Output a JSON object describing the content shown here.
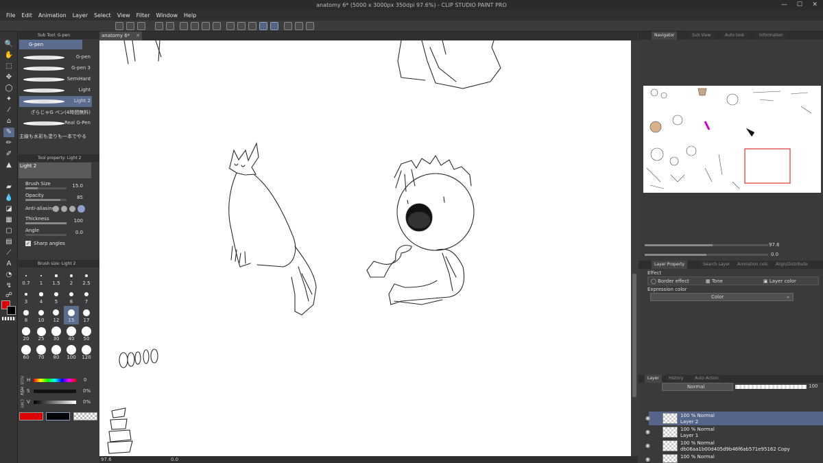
{
  "window": {
    "title": "anatomy 6* (5000 x 3000px 350dpi 97.6%) - CLIP STUDIO PAINT PRO",
    "controls": [
      "—",
      "☐",
      "✕"
    ]
  },
  "menu": [
    "File",
    "Edit",
    "Animation",
    "Layer",
    "Select",
    "View",
    "Filter",
    "Window",
    "Help"
  ],
  "subtool": {
    "panel_title": "Sub Tool: G-pen",
    "group": "G-pen",
    "brushes": [
      "G-pen",
      "G-pen 3",
      "SemiHard",
      "Light",
      "Light 2",
      "ざらじゃG ペン(4時間無料)",
      "Real G-Pen",
      "主線も水彩も塗りも一本でやる"
    ],
    "selected_index": 4
  },
  "tool_property": {
    "panel_title": "Tool property: Light 2",
    "preset": "Light 2",
    "props": [
      {
        "label": "Brush Size",
        "value": "15.0",
        "fill": 0.3
      },
      {
        "label": "Opacity",
        "value": "85",
        "fill": 0.85
      },
      {
        "label": "Anti-aliasing",
        "value": "",
        "fill": 0
      },
      {
        "label": "Thickness",
        "value": "100",
        "fill": 1.0
      },
      {
        "label": "Angle",
        "value": "0.0",
        "fill": 0
      }
    ],
    "sharp_angles": "Sharp angles"
  },
  "brush_size": {
    "panel_title": "Brush size: Light 2",
    "sizes": [
      "0.7",
      "1",
      "1.5",
      "2",
      "2.5",
      "3",
      "4",
      "5",
      "6",
      "7",
      "8",
      "10",
      "12",
      "15",
      "17",
      "20",
      "25",
      "30",
      "40",
      "50",
      "60",
      "70",
      "80",
      "100",
      "120"
    ],
    "selected": "15"
  },
  "color": {
    "mode_tabs": [
      "HSV",
      "RGB",
      "CMY"
    ],
    "sliders": [
      {
        "label": "H",
        "value": "0"
      },
      {
        "label": "S",
        "value": "0%"
      },
      {
        "label": "V",
        "value": "0%"
      }
    ],
    "main_color": "#dd0000",
    "sub_color": "#000000"
  },
  "canvas": {
    "tab_label": "anatomy 6*"
  },
  "status": {
    "zoom": "97.6",
    "angle": "0.0"
  },
  "navigator": {
    "tabs": [
      "Navigator",
      "Sub View",
      "Auto look",
      "Information"
    ],
    "zoom": "97.6",
    "rotate": "0.0"
  },
  "layer_property": {
    "tabs": [
      "Layer Property",
      "Search Layer",
      "Animation cels",
      "Align/Distribute"
    ],
    "effect_label": "Effect",
    "effects": [
      "Border effect",
      "Tone",
      "Layer color"
    ],
    "expression_label": "Expression color",
    "expression_value": "Color"
  },
  "layers_panel": {
    "tabs": [
      "Layer",
      "History",
      "Auto Action"
    ],
    "blend_mode": "Normal",
    "opacity": "100",
    "layers": [
      {
        "blend": "100 % Normal",
        "name": "Layer 2",
        "selected": true
      },
      {
        "blend": "100 % Normal",
        "name": "Layer 1",
        "selected": false
      },
      {
        "blend": "100 % Normal",
        "name": "db06aa1b00d405d9b46f6ab571e95162 Copy",
        "selected": false
      },
      {
        "blend": "100 % Normal",
        "name": "",
        "selected": false
      }
    ]
  }
}
